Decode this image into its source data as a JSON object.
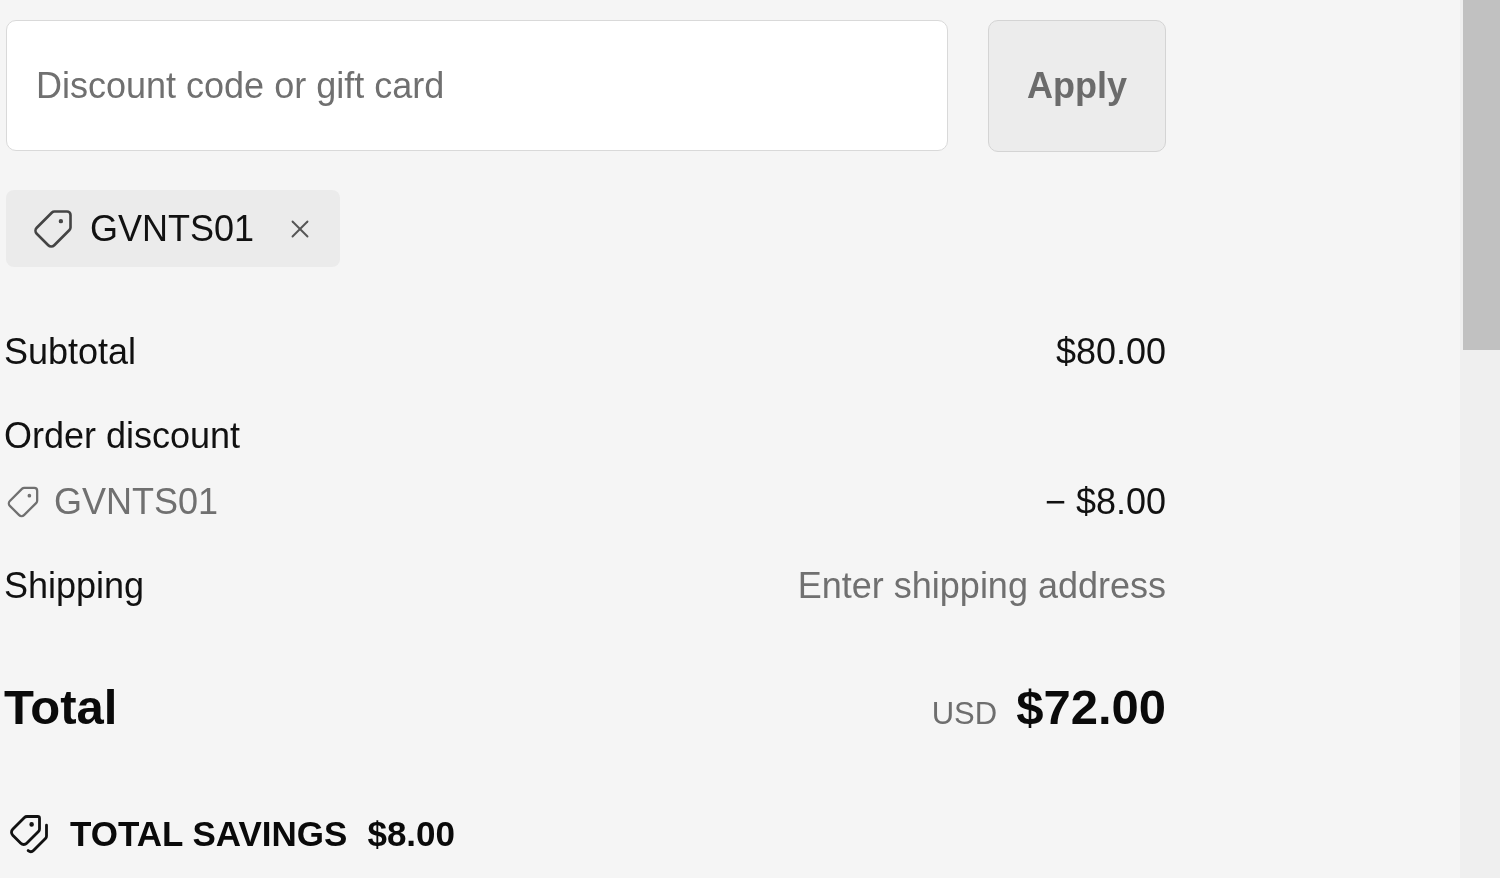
{
  "discount_form": {
    "field": {
      "placeholder": "Discount code or gift card"
    },
    "apply_button": "Apply"
  },
  "applied_codes": [
    {
      "code": "GVNTS01"
    }
  ],
  "summary": {
    "rows": [
      {
        "kind": "amount",
        "label": "Subtotal",
        "value": "$80.00"
      },
      {
        "kind": "discount",
        "label": "Order discount",
        "code": "GVNTS01",
        "value": "− $8.00"
      },
      {
        "kind": "note",
        "label": "Shipping",
        "value": "Enter shipping address"
      }
    ]
  },
  "total": {
    "label": "Total",
    "currency": "USD",
    "amount": "$72.00"
  },
  "savings": {
    "label": "TOTAL SAVINGS",
    "amount": "$8.00"
  }
}
